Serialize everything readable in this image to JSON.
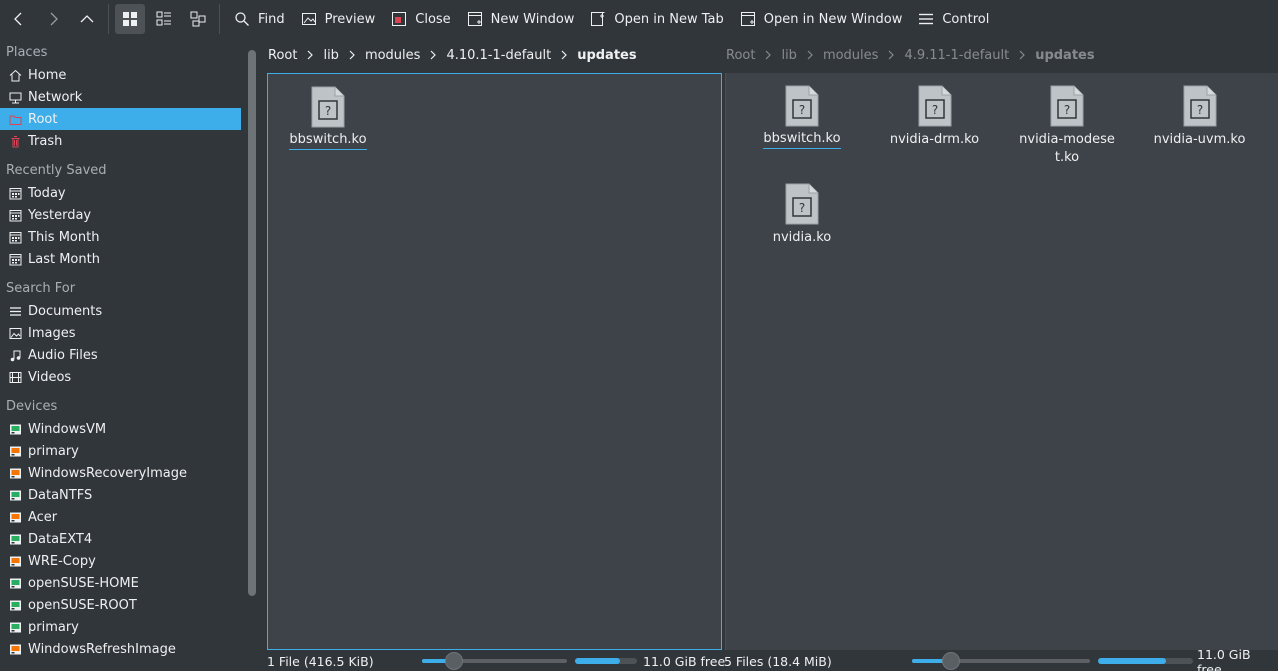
{
  "toolbar": {
    "back_label": "Back",
    "forward_label": "Forward",
    "up_label": "Up",
    "find": "Find",
    "preview": "Preview",
    "close": "Close",
    "new_window": "New Window",
    "open_new_tab": "Open in New Tab",
    "open_new_window": "Open in New Window",
    "control": "Control"
  },
  "sidebar": {
    "places_header": "Places",
    "places": [
      {
        "label": "Home",
        "icon": "home-icon"
      },
      {
        "label": "Network",
        "icon": "network-icon"
      },
      {
        "label": "Root",
        "icon": "root-folder-icon",
        "selected": true
      },
      {
        "label": "Trash",
        "icon": "trash-icon"
      }
    ],
    "recent_header": "Recently Saved",
    "recent": [
      {
        "label": "Today",
        "icon": "calendar-icon"
      },
      {
        "label": "Yesterday",
        "icon": "calendar-icon"
      },
      {
        "label": "This Month",
        "icon": "calendar-icon"
      },
      {
        "label": "Last Month",
        "icon": "calendar-icon"
      }
    ],
    "search_header": "Search For",
    "search": [
      {
        "label": "Documents",
        "icon": "documents-icon"
      },
      {
        "label": "Images",
        "icon": "images-icon"
      },
      {
        "label": "Audio Files",
        "icon": "audio-icon"
      },
      {
        "label": "Videos",
        "icon": "videos-icon"
      }
    ],
    "devices_header": "Devices",
    "devices": [
      {
        "label": "WindowsVM",
        "icon": "drive-mounted-icon"
      },
      {
        "label": "primary",
        "icon": "drive-unmounted-icon"
      },
      {
        "label": "WindowsRecoveryImage",
        "icon": "drive-unmounted-icon"
      },
      {
        "label": "DataNTFS",
        "icon": "drive-mounted-icon"
      },
      {
        "label": "Acer",
        "icon": "drive-unmounted-icon"
      },
      {
        "label": "DataEXT4",
        "icon": "drive-mounted-icon"
      },
      {
        "label": "WRE-Copy",
        "icon": "drive-unmounted-icon"
      },
      {
        "label": "openSUSE-HOME",
        "icon": "drive-mounted-icon"
      },
      {
        "label": "openSUSE-ROOT",
        "icon": "drive-mounted-icon"
      },
      {
        "label": "primary",
        "icon": "drive-mounted-icon"
      },
      {
        "label": "WindowsRefreshImage",
        "icon": "drive-unmounted-icon"
      }
    ]
  },
  "left_pane": {
    "breadcrumb": [
      "Root",
      "lib",
      "modules",
      "4.10.1-1-default",
      "updates"
    ],
    "files": [
      "bbswitch.ko"
    ],
    "status_text": "1 File (416.5 KiB)",
    "free_text": "11.0 GiB free",
    "zoom_fraction": 0.22,
    "used_fraction": 0.72
  },
  "right_pane": {
    "breadcrumb": [
      "Root",
      "lib",
      "modules",
      "4.9.11-1-default",
      "updates"
    ],
    "files": [
      "bbswitch.ko",
      "nvidia-drm.ko",
      "nvidia-modeset.ko",
      "nvidia-uvm.ko",
      "nvidia.ko"
    ],
    "status_text": "5 Files (18.4 MiB)",
    "free_text": "11.0 GiB free",
    "zoom_fraction": 0.22,
    "used_fraction": 0.72
  },
  "colors": {
    "accent": "#3daee9",
    "background": "#31363b",
    "pane": "#3e4349",
    "text": "#eff0f1"
  }
}
